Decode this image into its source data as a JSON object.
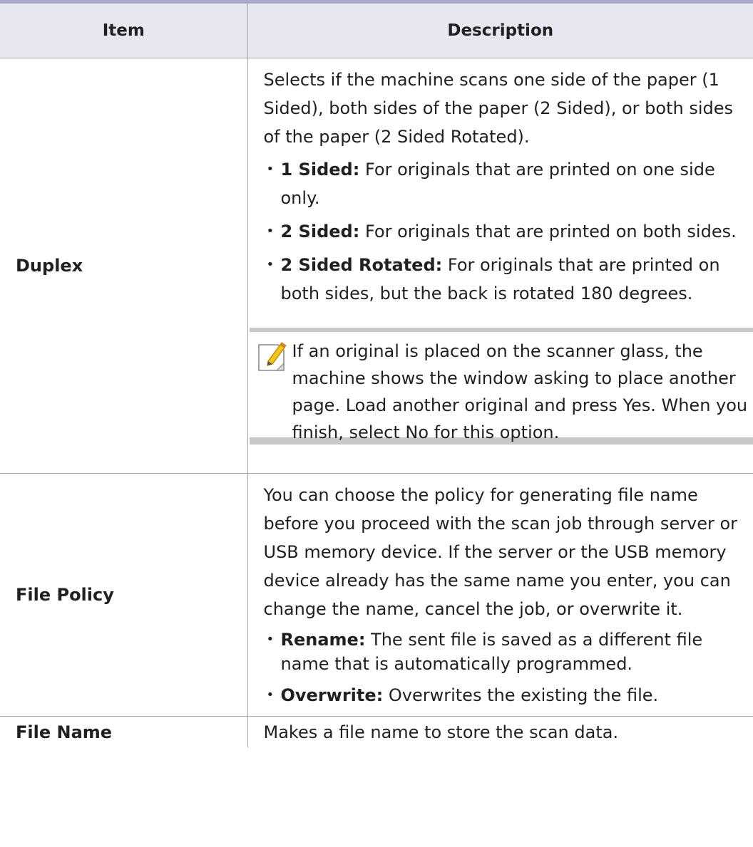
{
  "table": {
    "headers": {
      "item": "Item",
      "description": "Description"
    },
    "rows": [
      {
        "item": "Duplex",
        "intro": "Selects if the machine scans one side of the paper (1 Sided), both sides of the paper (2 Sided), or both sides of the paper (2 Sided Rotated).",
        "bullets": [
          {
            "term": "1 Sided:",
            "text": " For originals that are printed on one side only."
          },
          {
            "term": "2 Sided:",
            "text": " For originals that are printed on both sides."
          },
          {
            "term": "2 Sided Rotated:",
            "text": " For originals that are printed on both sides, but the back is rotated 180 degrees."
          }
        ],
        "note": {
          "icon": "note-pencil-icon",
          "text": "If an original is placed on the scanner glass, the machine shows the window asking to place another page. Load another original and press Yes. When you finish, select No for this option."
        }
      },
      {
        "item": "File Policy",
        "intro": "You can choose the policy for generating file name before you proceed with the scan job through server or USB memory device. If the server or the USB memory device already has the same name you enter, you can change the name, cancel the job, or overwrite it.",
        "bullets": [
          {
            "term": "Rename:",
            "text": " The sent file is saved as a different file name that is automatically programmed."
          },
          {
            "term": "Overwrite:",
            "text": " Overwrites the existing the file."
          }
        ]
      },
      {
        "item": "File Name",
        "intro": "Makes a file name to store the scan data."
      }
    ]
  },
  "colors": {
    "header_bg": "#e6e7f0",
    "top_rule": "#a8a9c9",
    "note_bar": "#c8c8c8"
  }
}
